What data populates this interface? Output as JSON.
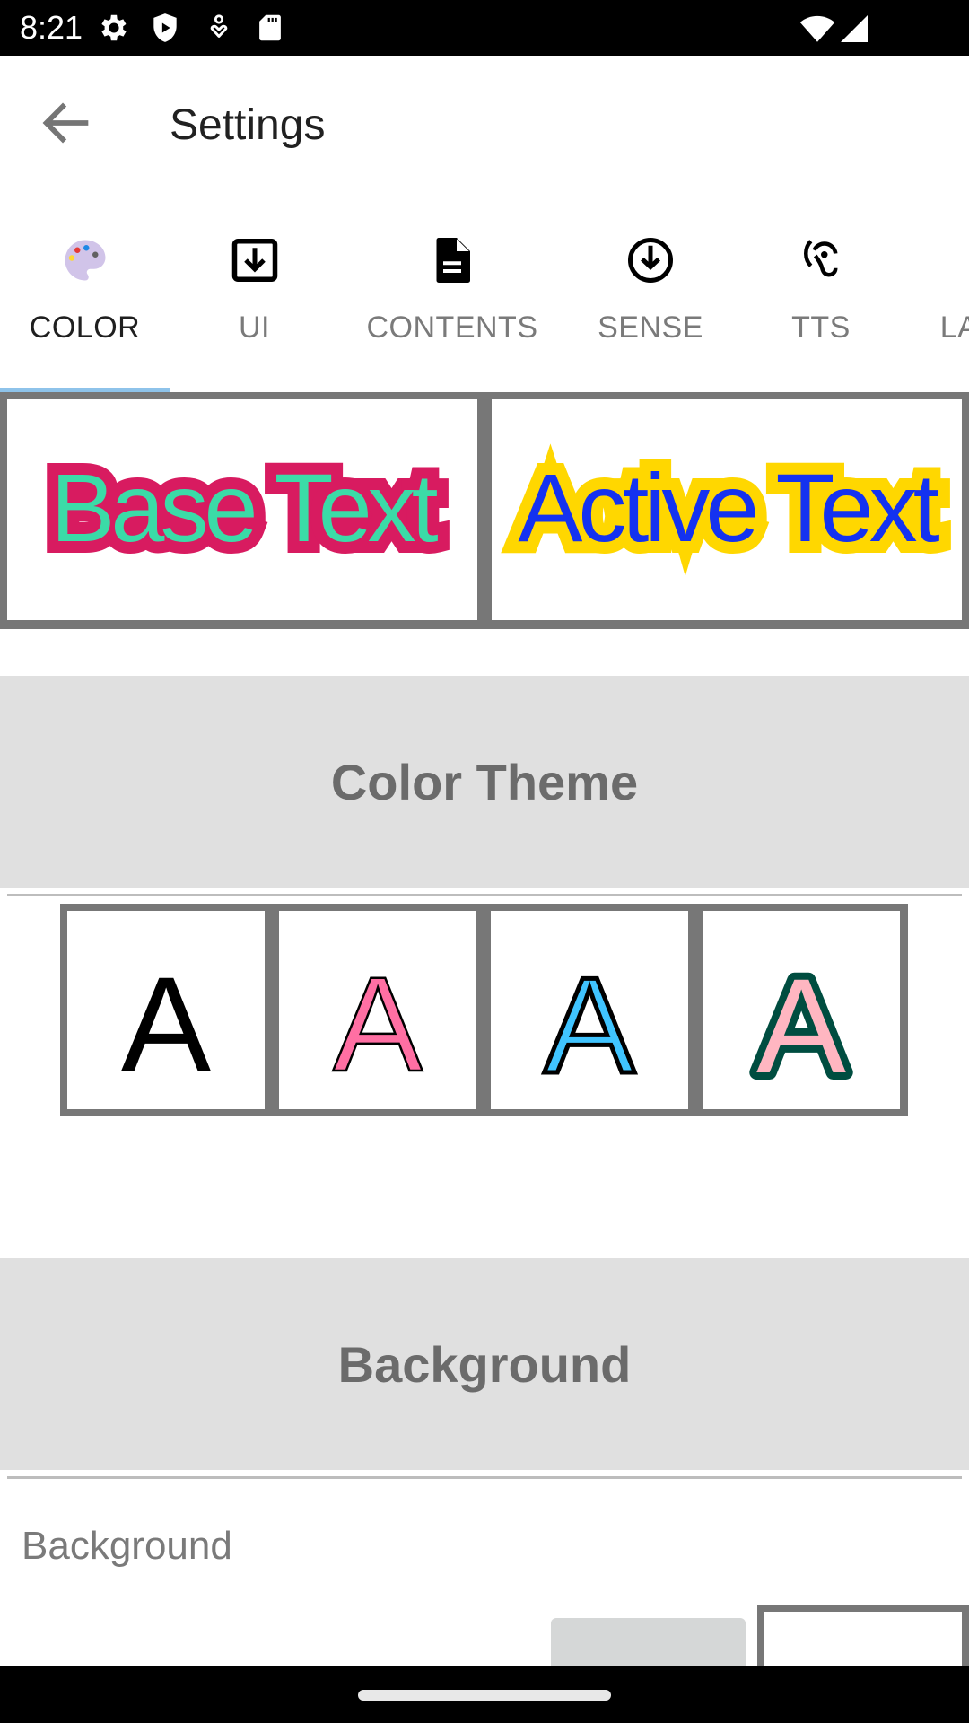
{
  "status_bar": {
    "time": "8:21",
    "left_icons": [
      "gear-icon",
      "shield-play-icon",
      "accessibility-heart-icon",
      "sd-card-icon"
    ],
    "right_icons": [
      "wifi-icon",
      "cell-signal-icon"
    ]
  },
  "app_bar": {
    "back_icon": "arrow-back-icon",
    "title": "Settings"
  },
  "tabs": [
    {
      "label": "COLOR",
      "icon": "palette-icon",
      "active": true
    },
    {
      "label": "UI",
      "icon": "download-box-icon",
      "active": false
    },
    {
      "label": "CONTENTS",
      "icon": "document-icon",
      "active": false
    },
    {
      "label": "SENSE",
      "icon": "arrow-circle-down-icon",
      "active": false
    },
    {
      "label": "TTS",
      "icon": "hearing-icon",
      "active": false
    },
    {
      "label": "LA",
      "icon": "",
      "active": false
    }
  ],
  "preview": {
    "base": {
      "text": "Base Text",
      "fill": "#3bdba7",
      "outline": "#d81b60"
    },
    "active": {
      "text": "Active Text",
      "fill": "#1432f0",
      "outline": "#ffd700"
    }
  },
  "sections": {
    "color_theme": "Color Theme",
    "background": "Background"
  },
  "color_themes": [
    {
      "glyph": "A",
      "fill": "#000000",
      "outline": "#000000"
    },
    {
      "glyph": "A",
      "fill": "#ff6fa3",
      "outline": "#000000"
    },
    {
      "glyph": "A",
      "fill": "#40c4ff",
      "outline": "#000000"
    },
    {
      "glyph": "A",
      "fill": "#ffb6c1",
      "outline": "#004d40"
    }
  ],
  "background_setting": {
    "label": "Background",
    "swatches": [
      "#d5d7d7",
      "#ffffff"
    ]
  },
  "colors": {
    "tab_indicator": "#8ec3ea",
    "frame": "#777777",
    "section_bg": "#e0e0e0"
  }
}
